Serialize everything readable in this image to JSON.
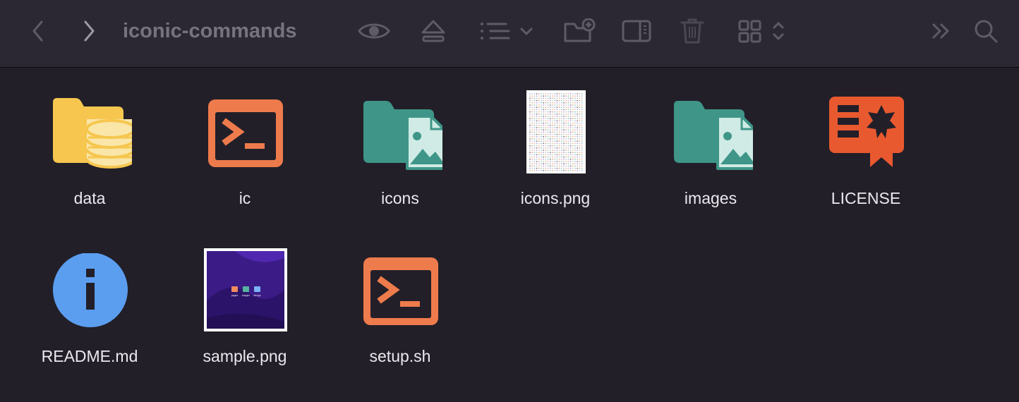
{
  "window": {
    "title": "iconic-commands"
  },
  "toolbar": {
    "buttons": [
      {
        "name": "back",
        "icon": "chevron-left-icon"
      },
      {
        "name": "forward",
        "icon": "chevron-right-icon"
      },
      {
        "name": "quick-look",
        "icon": "eye-icon"
      },
      {
        "name": "eject",
        "icon": "eject-icon"
      },
      {
        "name": "view-options",
        "icon": "list-view-icon"
      },
      {
        "name": "new-folder",
        "icon": "folder-plus-icon"
      },
      {
        "name": "sidebar-toggle",
        "icon": "sidebar-icon"
      },
      {
        "name": "trash",
        "icon": "trash-icon"
      },
      {
        "name": "icon-view",
        "icon": "grid-icon"
      },
      {
        "name": "more",
        "icon": "double-chevron-right-icon"
      },
      {
        "name": "search",
        "icon": "search-icon"
      }
    ]
  },
  "files": [
    {
      "name": "data",
      "icon": "database-folder-icon"
    },
    {
      "name": "ic",
      "icon": "terminal-icon"
    },
    {
      "name": "icons",
      "icon": "image-folder-icon"
    },
    {
      "name": "icons.png",
      "icon": "image-thumbnail"
    },
    {
      "name": "images",
      "icon": "image-folder-icon"
    },
    {
      "name": "LICENSE",
      "icon": "license-icon"
    },
    {
      "name": "README.md",
      "icon": "info-icon"
    },
    {
      "name": "sample.png",
      "icon": "image-thumbnail"
    },
    {
      "name": "setup.sh",
      "icon": "terminal-icon"
    }
  ],
  "sample_thumbnail": {
    "labels": [
      "pages",
      "images",
      "design"
    ]
  },
  "colors": {
    "background": "#221f29",
    "toolbar": "#2b2833",
    "folder_yellow": "#f6c64f",
    "folder_teal": "#3f9688",
    "terminal_orange": "#ee7b4c",
    "license_red": "#e9592f",
    "info_blue": "#5b9ef0"
  }
}
